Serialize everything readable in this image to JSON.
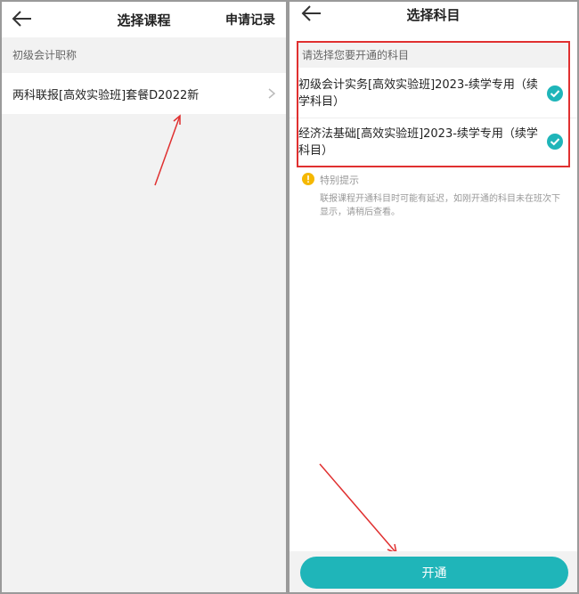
{
  "left_panel": {
    "header": {
      "title": "选择课程",
      "apply_record_label": "申请记录"
    },
    "section_title": "初级会计职称",
    "course_item": {
      "label": "两科联报[高效实验班]套餐D2022新"
    }
  },
  "right_panel": {
    "header": {
      "title": "选择科目"
    },
    "section_title": "请选择您要开通的科目",
    "subjects": [
      {
        "label": "初级会计实务[高效实验班]2023-续学专用（续学科目）",
        "checked": true
      },
      {
        "label": "经济法基础[高效实验班]2023-续学专用（续学科目）",
        "checked": true
      }
    ],
    "notice": {
      "title": "特别提示",
      "text": "联报课程开通科目时可能有延迟，如刚开通的科目未在班次下显示，请稍后查看。"
    },
    "open_button_label": "开通"
  },
  "colors": {
    "accent": "#1fb5b9",
    "annotation_red": "#e03030",
    "notice_icon": "#f5b800",
    "section_bg": "#f2f2f2"
  }
}
